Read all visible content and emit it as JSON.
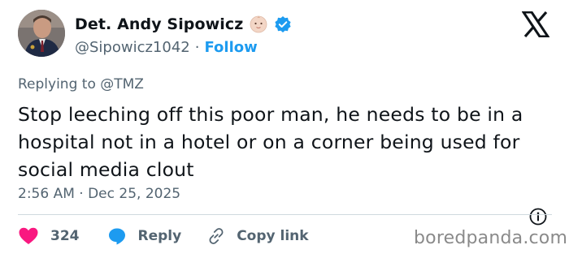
{
  "author": {
    "display_name": "Det. Andy Sipowicz",
    "handle": "@Sipowicz1042",
    "separator": "·",
    "follow_label": "Follow",
    "badge_emoji": "👶🏻",
    "verified_icon": "verified-badge-icon"
  },
  "reply_context": {
    "prefix": "Replying to",
    "mention": "@TMZ"
  },
  "tweet": {
    "text": "Stop leeching off this poor man, he needs to be in a hospital not in a hotel or on a corner being used for social media clout",
    "timestamp": "2:56 AM · Dec 25, 2025"
  },
  "actions": {
    "like_count": "324",
    "reply_label": "Reply",
    "copy_link_label": "Copy link"
  },
  "watermark": "boredpanda.com",
  "colors": {
    "accent": "#1d9bf0",
    "like": "#f91880",
    "reply": "#1d9bf0",
    "text": "#0f1419",
    "muted": "#536471"
  }
}
